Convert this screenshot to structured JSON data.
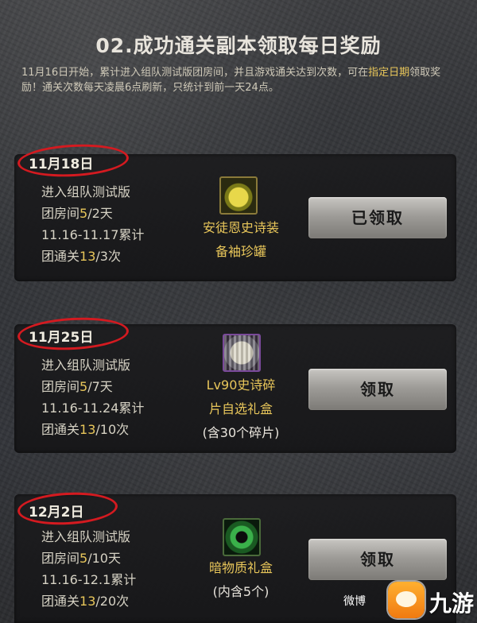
{
  "header": {
    "title": "02.成功通关副本领取每日奖励",
    "desc_part1": "11月16日开始，累计进入组队测试版团房间，并且游戏通关达到次数，可在",
    "desc_highlight": "指定日期",
    "desc_part2": "领取奖励！通关次数每天凌晨6点刷新，只统计到前一天24点。"
  },
  "rewards": [
    {
      "date": "11月18日",
      "line1": "进入组队测试版",
      "line2_pre": "团房间",
      "line2_num": "5",
      "line2_post": "/2天",
      "line3": "11.16-11.17累计",
      "line4_pre": "团通关",
      "line4_num": "13",
      "line4_post": "/3次",
      "icon": "jar-icon",
      "reward_line1": "安徒恩史诗装",
      "reward_line2": "备袖珍罐",
      "button_label": "已领取"
    },
    {
      "date": "11月25日",
      "line1": "进入组队测试版",
      "line2_pre": "团房间",
      "line2_num": "5",
      "line2_post": "/7天",
      "line3": "11.16-11.24累计",
      "line4_pre": "团通关",
      "line4_num": "13",
      "line4_post": "/10次",
      "icon": "gift-box-icon",
      "reward_line1": "Lv90史诗碎",
      "reward_line2": "片自选礼盒",
      "reward_line3": "(含30个碎片)",
      "button_label": "领取"
    },
    {
      "date": "12月2日",
      "line1": "进入组队测试版",
      "line2_pre": "团房间",
      "line2_num": "5",
      "line2_post": "/10天",
      "line3": "11.16-12.1累计",
      "line4_pre": "团通关",
      "line4_num": "13",
      "line4_post": "/20次",
      "icon": "orb-icon",
      "reward_line1": "暗物质礼盒",
      "reward_line2": "(内含5个)",
      "button_label": "领取"
    }
  ],
  "watermark": {
    "weibo": "微博",
    "brand": "九游"
  },
  "colors": {
    "highlight": "#e8c65a",
    "circle": "#d41a20"
  }
}
